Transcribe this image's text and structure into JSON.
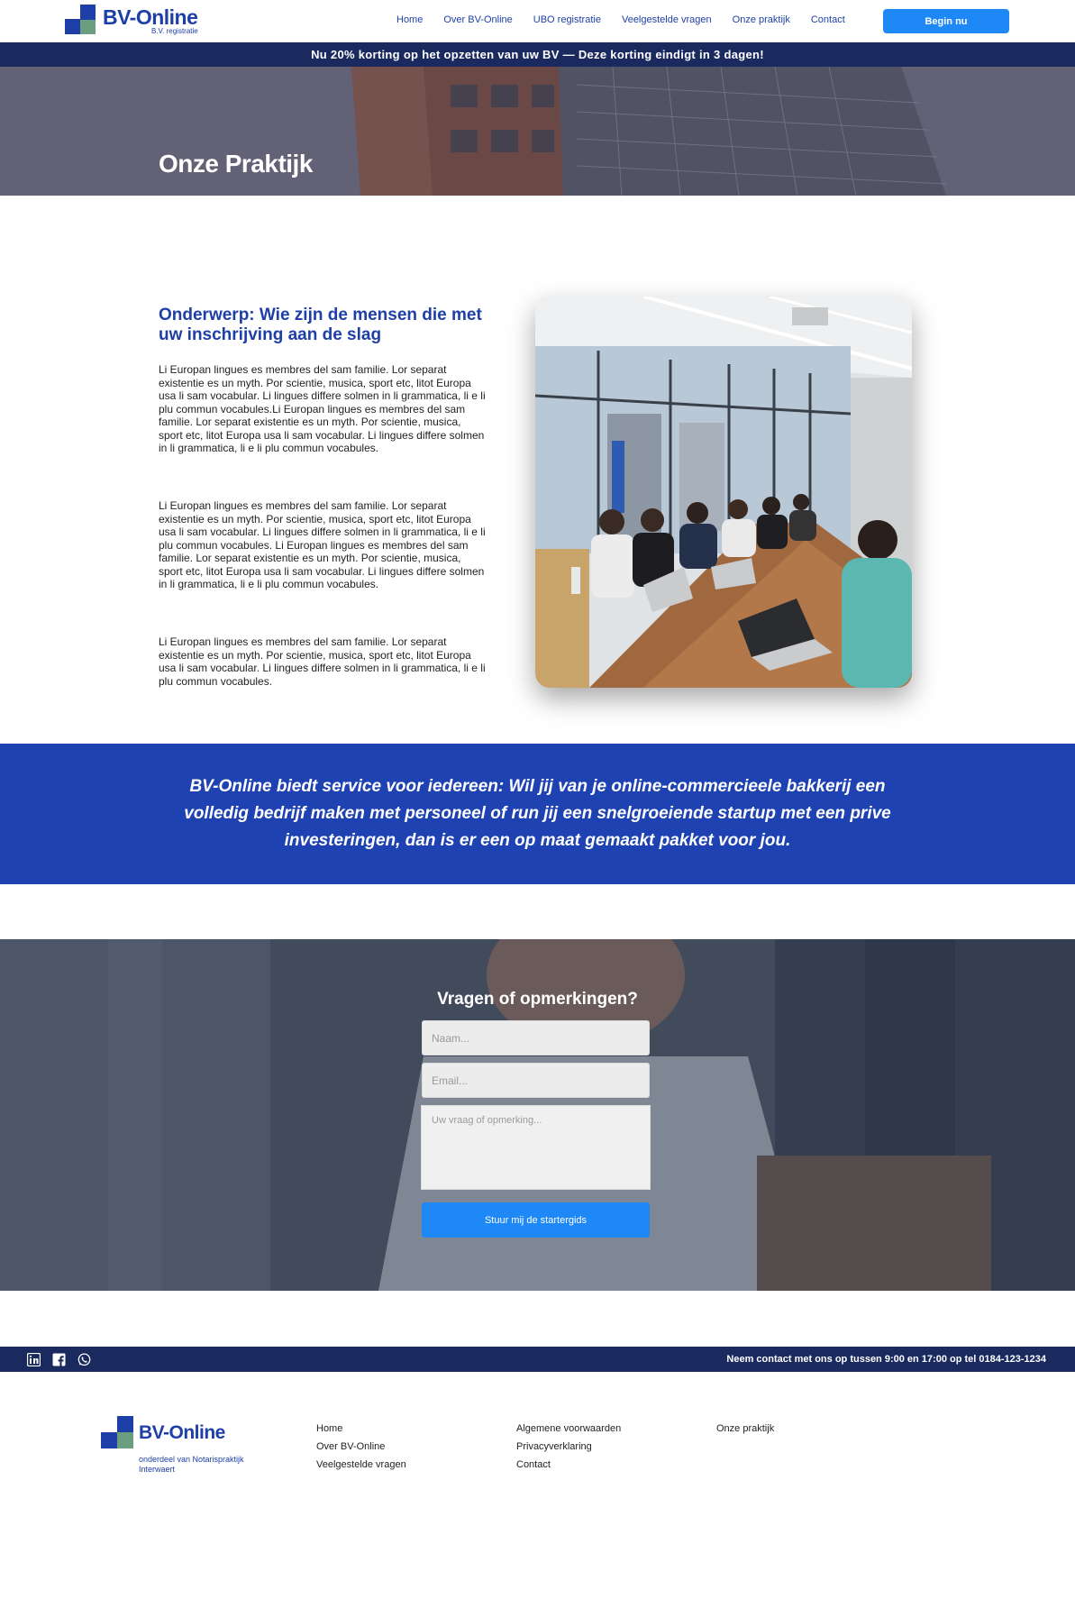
{
  "header": {
    "logo_name": "BV-Online",
    "logo_sub": "B.V. registratie",
    "nav": [
      "Home",
      "Over BV-Online",
      "UBO registratie",
      "Veelgestelde vragen",
      "Onze praktijk",
      "Contact"
    ],
    "cta": "Begin nu"
  },
  "promo": "Nu 20% korting op het opzetten van uw BV — Deze korting eindigt in 3 dagen!",
  "hero": {
    "title": "Onze Praktijk"
  },
  "content": {
    "title": "Onderwerp: Wie zijn de mensen die met uw inschrijving aan de slag",
    "paragraphs": [
      "Li Europan lingues es membres del sam familie. Lor separat existentie es un myth. Por scientie, musica, sport etc, litot Europa usa li sam vocabular. Li lingues differe solmen in li grammatica, li  e li plu commun vocabules.Li Europan lingues es membres del sam familie. Lor separat existentie es un myth. Por scientie, musica, sport etc, litot Europa usa li sam vocabular. Li lingues differe solmen in li grammatica, li  e li plu commun vocabules.",
      "Li Europan lingues es membres del sam familie. Lor separat existentie es un myth. Por scientie, musica, sport etc, litot Europa usa li sam vocabular. Li lingues differe solmen in li grammatica, li  e li plu commun vocabules. Li Europan lingues es membres del sam familie. Lor separat existentie es un myth. Por scientie, musica, sport etc, litot Europa usa li sam vocabular. Li lingues differe solmen in li grammatica, li  e li plu commun vocabules.",
      "Li Europan lingues es membres del sam familie. Lor separat existentie es un myth. Por scientie, musica, sport etc, litot Europa usa li sam vocabular. Li lingues differe solmen in li grammatica, li  e li plu commun vocabules."
    ]
  },
  "band": "BV-Online biedt service voor iedereen: Wil jij van je online-commercieele bakkerij een volledig bedrijf maken met personeel of run jij een snelgroeiende startup met een prive investeringen, dan is er een op maat gemaakt pakket voor jou.",
  "contact": {
    "title": "Vragen of opmerkingen?",
    "name_placeholder": "Naam...",
    "email_placeholder": "Email...",
    "message_placeholder": "Uw vraag of opmerking...",
    "submit": "Stuur mij de startergids"
  },
  "footer": {
    "note": "Neem contact met ons op tussen 9:00 en 17:00 op tel 0184-123-1234",
    "social_icons": [
      "linkedin-icon",
      "facebook-icon",
      "whatsapp-icon"
    ],
    "logo_name": "BV-Online",
    "logo_sub": "onderdeel van Notarispraktijk Interwaert",
    "col1": [
      "Home",
      "Over BV-Online",
      "Veelgestelde vragen"
    ],
    "col2": [
      "Algemene voorwaarden",
      "Privacyverklaring",
      "Contact"
    ],
    "col3": [
      "Onze praktijk"
    ]
  },
  "colors": {
    "brand_blue": "#1e3fa8",
    "navy": "#1a2a5e",
    "button_blue": "#1e88f7",
    "band_blue": "#1e42b2"
  }
}
